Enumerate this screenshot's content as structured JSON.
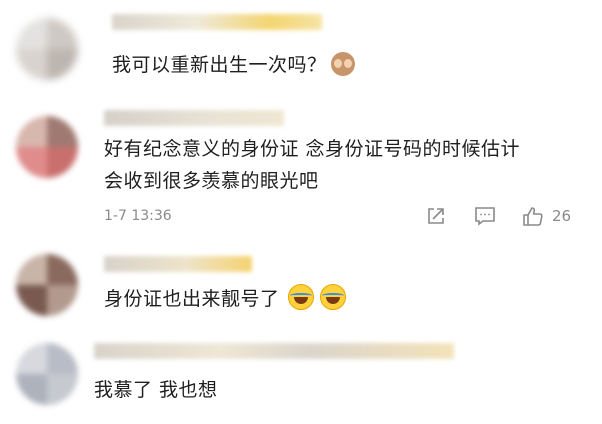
{
  "comments": [
    {
      "text": "我可以重新出生一次吗？",
      "emoji": "see-no-evil-monkey"
    },
    {
      "text_line1": "好有纪念意义的身份证 念身份证号码的时候估计",
      "text_line2": "会收到很多羡慕的眼光吧",
      "timestamp": "1-7 13:36",
      "like_count": "26"
    },
    {
      "text": "身份证也出来靓号了",
      "emoji": "laughing-crying"
    },
    {
      "text": "我慕了 我也想"
    }
  ],
  "icons": {
    "share": "share-icon",
    "comment": "comment-icon",
    "like": "thumbs-up-icon"
  },
  "colors": {
    "name_blur": "#f3d36a",
    "meta_text": "#8a8a8a"
  }
}
